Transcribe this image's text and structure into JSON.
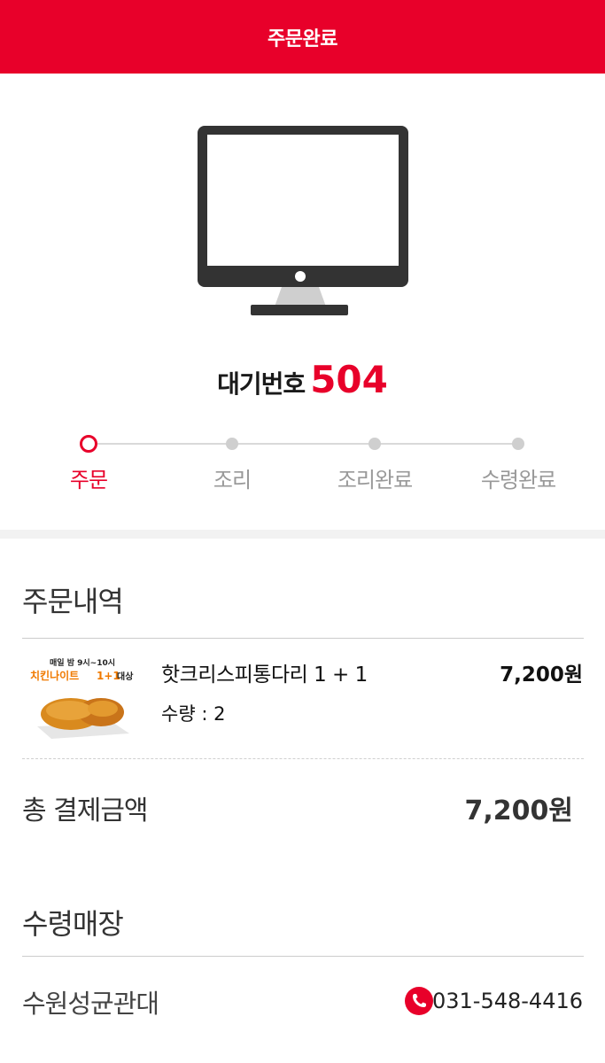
{
  "header": {
    "title": "주문완료"
  },
  "status": {
    "icon": "monitor-icon",
    "waiting_label": "대기번호",
    "waiting_number": "504"
  },
  "progress": {
    "current_step": 0,
    "steps": [
      {
        "label": "주문"
      },
      {
        "label": "조리"
      },
      {
        "label": "조리완료"
      },
      {
        "label": "수령완료"
      }
    ]
  },
  "order": {
    "title": "주문내역",
    "items": [
      {
        "name": "핫크리스피통다리 1 + 1",
        "quantity": "수량 : 2",
        "price": "7,200원",
        "image": {
          "banner_top": "매일 밤 9시~10시",
          "banner_main": "치킨나이트",
          "banner_deal": "1+1",
          "banner_suffix": "대상"
        }
      }
    ],
    "total_label": "총 결제금액",
    "total_value": "7,200원"
  },
  "store": {
    "title": "수령매장",
    "name": "수원성균관대",
    "phone_icon": "phone-icon",
    "phone": "031-548-4416"
  },
  "colors": {
    "accent": "#e8002a",
    "dark": "#333333",
    "inactive": "#cfcfcf"
  }
}
